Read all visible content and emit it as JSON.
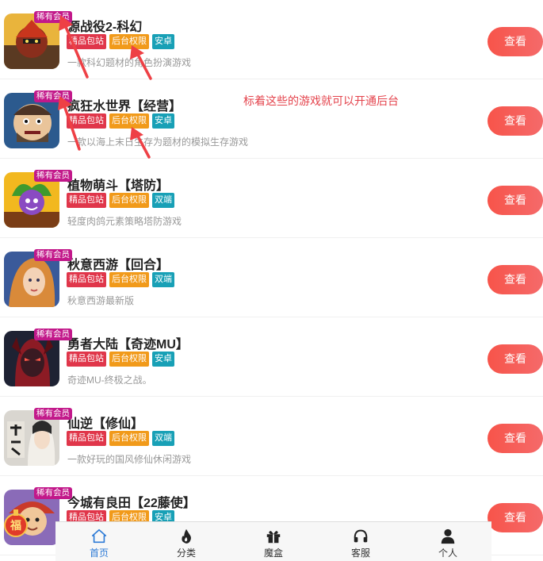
{
  "games": [
    {
      "title": "源战役2-科幻",
      "vip": "稀有会员",
      "tags": [
        "精品包站",
        "后台权限",
        "安卓"
      ],
      "tag_colors": [
        "red",
        "orange",
        "teal"
      ],
      "desc": "一款科幻题材的角色扮演游戏",
      "button": "查看",
      "art": "warrior-icon"
    },
    {
      "title": "疯狂水世界【经营】",
      "vip": "稀有会员",
      "tags": [
        "精品包站",
        "后台权限",
        "安卓"
      ],
      "tag_colors": [
        "red",
        "orange",
        "teal"
      ],
      "desc": "一款以海上末日生存为题材的模拟生存游戏",
      "button": "查看",
      "art": "pirate-icon"
    },
    {
      "title": "植物萌斗【塔防】",
      "vip": "稀有会员",
      "tags": [
        "精品包站",
        "后台权限",
        "双端"
      ],
      "tag_colors": [
        "red",
        "orange",
        "teal"
      ],
      "desc": "轻度肉鸽元素策略塔防游戏",
      "button": "查看",
      "art": "plant-icon"
    },
    {
      "title": "秋意西游【回合】",
      "vip": "稀有会员",
      "tags": [
        "精品包站",
        "后台权限",
        "双端"
      ],
      "tag_colors": [
        "red",
        "orange",
        "teal"
      ],
      "desc": "秋意西游最新版",
      "button": "查看",
      "art": "heroine-icon"
    },
    {
      "title": "勇者大陆【奇迹MU】",
      "vip": "稀有会员",
      "tags": [
        "精品包站",
        "后台权限",
        "安卓"
      ],
      "tag_colors": [
        "red",
        "orange",
        "teal"
      ],
      "desc": "奇迹MU-终极之战。",
      "button": "查看",
      "art": "demon-icon"
    },
    {
      "title": "仙逆【修仙】",
      "vip": "稀有会员",
      "tags": [
        "精品包站",
        "后台权限",
        "双端"
      ],
      "tag_colors": [
        "red",
        "orange",
        "teal"
      ],
      "desc": "一款好玩的国风修仙休闲游戏",
      "button": "查看",
      "art": "xian-icon"
    },
    {
      "title": "今城有良田【22藤使】",
      "vip": "稀有会员",
      "tags": [
        "精品包站",
        "后台权限",
        "安卓"
      ],
      "tag_colors": [
        "red",
        "orange",
        "teal"
      ],
      "desc": "",
      "button": "查看",
      "art": "farmer-icon"
    }
  ],
  "annotation": "标着这些的游戏就可以开通后台",
  "float_badge": "福",
  "tabbar": [
    {
      "label": "首页",
      "icon": "home-icon",
      "active": true
    },
    {
      "label": "分类",
      "icon": "fire-icon",
      "active": false
    },
    {
      "label": "魔盒",
      "icon": "gift-icon",
      "active": false
    },
    {
      "label": "客服",
      "icon": "headset-icon",
      "active": false
    },
    {
      "label": "个人",
      "icon": "user-icon",
      "active": false
    }
  ],
  "colors": {
    "accent": "#2e7bd6",
    "button": "#f7544a",
    "vip": "#c2188a",
    "annotation": "#e4434c"
  }
}
